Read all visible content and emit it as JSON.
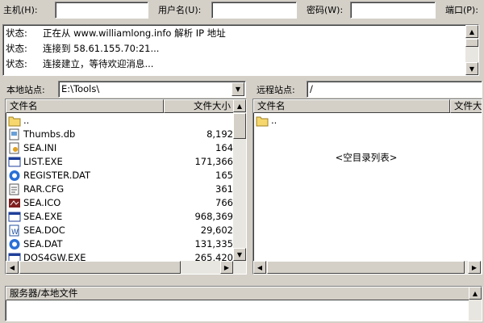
{
  "quickconnect": {
    "host_label": "主机(H):",
    "host_value": "",
    "user_label": "用户名(U):",
    "user_value": "",
    "password_label": "密码(W):",
    "password_value": "",
    "port_label": "端口(P):",
    "port_value": ""
  },
  "status_log": [
    {
      "key": "状态:",
      "message": "正在从 www.williamlong.info 解析 IP 地址"
    },
    {
      "key": "状态:",
      "message": "连接到 58.61.155.70:21..."
    },
    {
      "key": "状态:",
      "message": "连接建立，等待欢迎消息..."
    }
  ],
  "local_site": {
    "label": "本地站点:",
    "path": "E:\\Tools\\",
    "columns": {
      "name": "文件名",
      "size": "文件大小"
    },
    "files": [
      {
        "name": "..",
        "size": "",
        "icon": "folder-up-icon"
      },
      {
        "name": "Thumbs.db",
        "size": "8,192",
        "icon": "db-file-icon"
      },
      {
        "name": "SEA.INI",
        "size": "164",
        "icon": "ini-file-icon"
      },
      {
        "name": "LIST.EXE",
        "size": "171,366",
        "icon": "exe-file-icon"
      },
      {
        "name": "REGISTER.DAT",
        "size": "165",
        "icon": "dat-file-icon"
      },
      {
        "name": "RAR.CFG",
        "size": "361",
        "icon": "cfg-file-icon"
      },
      {
        "name": "SEA.ICO",
        "size": "766",
        "icon": "ico-file-icon"
      },
      {
        "name": "SEA.EXE",
        "size": "968,369",
        "icon": "exe-file-icon"
      },
      {
        "name": "SEA.DOC",
        "size": "29,602",
        "icon": "doc-file-icon"
      },
      {
        "name": "SEA.DAT",
        "size": "131,335",
        "icon": "dat-file-icon"
      },
      {
        "name": "DOS4GW.EXE",
        "size": "265,420",
        "icon": "exe-file-icon"
      }
    ]
  },
  "remote_site": {
    "label": "远程站点:",
    "path": "/",
    "columns": {
      "name": "文件名",
      "size": "文件大"
    },
    "files": [
      {
        "name": "..",
        "icon": "folder-up-icon"
      }
    ],
    "empty_text": "<空目录列表>"
  },
  "queue": {
    "header": "服务器/本地文件"
  },
  "colors": {
    "window_bg": "#d4d0c8",
    "folder": "#f5d76e",
    "exe_blue": "#1f3f99",
    "dat_blue": "#2a6fd6"
  }
}
